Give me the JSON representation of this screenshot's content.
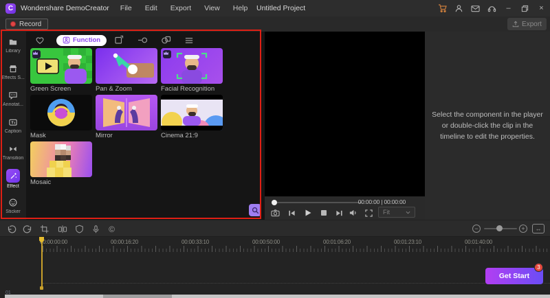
{
  "titlebar": {
    "app_title": "Wondershare DemoCreator",
    "project_title": "Untitled Project",
    "menus": [
      "File",
      "Edit",
      "Export",
      "View",
      "Help"
    ]
  },
  "actions": {
    "record_label": "Record",
    "export_label": "Export"
  },
  "sidebar": {
    "items": [
      {
        "label": "Library"
      },
      {
        "label": "Effects S..."
      },
      {
        "label": "Annotat..."
      },
      {
        "label": "Caption"
      },
      {
        "label": "Transition"
      },
      {
        "label": "Effect",
        "active": true
      },
      {
        "label": "Sticker"
      }
    ]
  },
  "effects_panel": {
    "function_tab_label": "Function",
    "items": [
      {
        "label": "Green Screen",
        "premium": true
      },
      {
        "label": "Pan & Zoom",
        "premium": false
      },
      {
        "label": "Facial Recognition",
        "premium": true
      },
      {
        "label": "Mask",
        "premium": false
      },
      {
        "label": "Mirror",
        "premium": false
      },
      {
        "label": "Cinema 21:9",
        "premium": false
      },
      {
        "label": "Mosaic",
        "premium": false
      }
    ]
  },
  "player": {
    "placeholder_message": "Select the component in the player or double-click the clip in the timeline to edit the properties.",
    "time_display": "00:00:00 | 00:00:00",
    "fit_label": "Fit"
  },
  "timeline": {
    "ruler_labels": [
      "00:00:00:00",
      "00:00:16:20",
      "00:00:33:10",
      "00:00:50:00",
      "00:01:06:20",
      "00:01:23:10",
      "00:01:40:00"
    ],
    "track_label": "01",
    "get_start_label": "Get Start",
    "notification_count": "3"
  },
  "icons": {
    "logo_glyph": "C",
    "minimize": "–",
    "close": "×",
    "copyright": "©",
    "zoom_out": "−",
    "zoom_in": "+",
    "fit_timeline": "↔"
  },
  "colors": {
    "accent_purple": "#8b46f0",
    "annotation_red": "#e01f14",
    "record_red": "#e04545",
    "badge_red": "#e5483e",
    "playhead_yellow": "#c9a02a"
  }
}
